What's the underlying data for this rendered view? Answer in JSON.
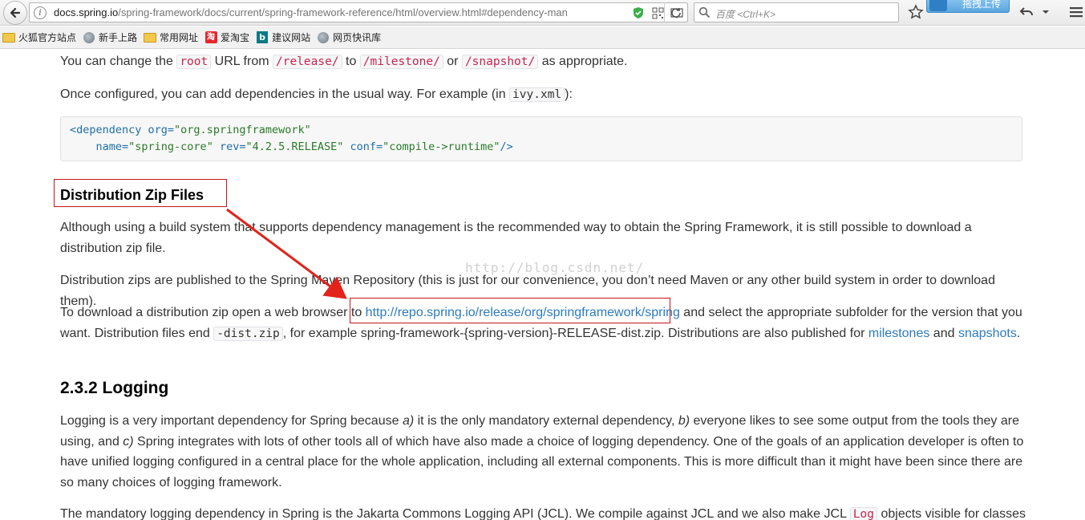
{
  "browser": {
    "url_host": "docs.spring.io",
    "url_path": "/spring-framework/docs/current/spring-framework-reference/html/overview.html#dependency-man",
    "search_placeholder": "百度 <Ctrl+K>",
    "upload_label": "拖拽上传"
  },
  "bookmarks": [
    {
      "label": "火狐官方站点",
      "icon": "folder-icon"
    },
    {
      "label": "新手上路",
      "icon": "gear-globe-icon"
    },
    {
      "label": "常用网址",
      "icon": "folder-icon"
    },
    {
      "label": "爱淘宝",
      "icon": "taobao-icon"
    },
    {
      "label": "建议网站",
      "icon": "bing-icon"
    },
    {
      "label": "网页快讯库",
      "icon": "globe-icon"
    }
  ],
  "page": {
    "p1": {
      "before": "You can change the ",
      "code1": "root",
      "mid1": " URL from ",
      "code2": "/release/",
      "mid2": " to ",
      "code3": "/milestone/",
      "mid3": " or ",
      "code4": "/snapshot/",
      "after": " as appropriate."
    },
    "p2": {
      "before": "Once configured, you can add dependencies in the usual way. For example (in ",
      "code": "ivy.xml",
      "after": "):"
    },
    "codeblock": {
      "line1_tag": "<dependency",
      "line1_attr": " org=",
      "line1_val": "\"org.springframework\"",
      "line2_attr1": "    name=",
      "line2_val1": "\"spring-core\"",
      "line2_attr2": " rev=",
      "line2_val2": "\"4.2.5.RELEASE\"",
      "line2_attr3": " conf=",
      "line2_val3": "\"compile->runtime\"",
      "line2_end": "/>"
    },
    "section_title": "Distribution Zip Files",
    "p3": "Although using a build system that supports dependency management is the recommended way to obtain the Spring Framework, it is still possible to download a distribution zip file.",
    "p4": "Distribution zips are published to the Spring Maven Repository (this is just for our convenience, you don’t need Maven or any other build system in order to download them).",
    "p5": {
      "before": "To download a distribution zip open a web browser to ",
      "link": "http://repo.spring.io/release/org/springframework/spring",
      "mid": " and select the appropriate subfolder for the version that you want. Distribution files end ",
      "code": "-dist.zip",
      "mid2": ", for example spring-framework-{spring-version}-RELEASE-dist.zip. Distributions are also published for ",
      "link2": "milestones",
      "mid3": " and ",
      "link3": "snapshots",
      "after": "."
    },
    "logging_title": "2.3.2 Logging",
    "p6": {
      "s1": "Logging is a very important dependency for Spring because ",
      "a": "a)",
      "s2": " it is the only mandatory external dependency, ",
      "b": "b)",
      "s3": " everyone likes to see some output from the tools they are using, and ",
      "c": "c)",
      "s4": " Spring integrates with lots of other tools all of which have also made a choice of logging dependency. One of the goals of an application developer is often to have unified logging configured in a central place for the whole application, including all external components. This is more difficult than it might have been since there are so many choices of logging framework."
    },
    "p7": {
      "before": "The mandatory logging dependency in Spring is the Jakarta Commons Logging API (JCL). We compile against JCL and we also make JCL ",
      "code": "Log",
      "after": " objects visible for classes"
    },
    "watermark": "http://blog.csdn.net/"
  },
  "colors": {
    "annotation": "#c5161d",
    "link": "#2c7bbf"
  }
}
